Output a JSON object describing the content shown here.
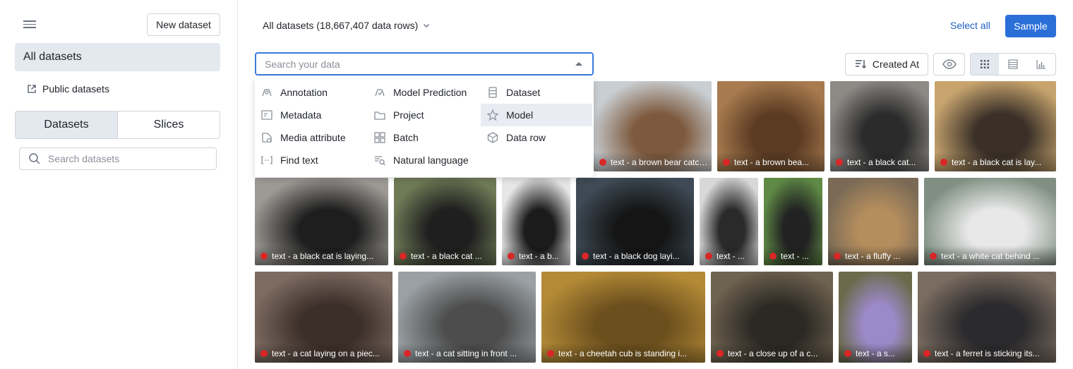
{
  "sidebar": {
    "new_dataset": "New dataset",
    "all_datasets": "All datasets",
    "public_datasets": "Public datasets",
    "tabs": [
      "Datasets",
      "Slices"
    ],
    "search_placeholder": "Search datasets"
  },
  "header": {
    "title": "All datasets (18,667,407 data rows)",
    "select_all": "Select all",
    "sample": "Sample"
  },
  "search": {
    "placeholder": "Search your data"
  },
  "toolbar": {
    "sort_label": "Created At"
  },
  "filters": [
    {
      "label": "Annotation",
      "icon": "annotation-icon"
    },
    {
      "label": "Model Prediction",
      "icon": "model-prediction-icon"
    },
    {
      "label": "Dataset",
      "icon": "dataset-icon"
    },
    {
      "label": "Metadata",
      "icon": "metadata-icon"
    },
    {
      "label": "Project",
      "icon": "folder-icon"
    },
    {
      "label": "Model",
      "icon": "model-icon"
    },
    {
      "label": "Media attribute",
      "icon": "media-attribute-icon"
    },
    {
      "label": "Batch",
      "icon": "batch-icon"
    },
    {
      "label": "Data row",
      "icon": "data-row-icon"
    },
    {
      "label": "Find text",
      "icon": "find-text-icon"
    },
    {
      "label": "Natural language",
      "icon": "natural-language-icon"
    }
  ],
  "tiles": [
    {
      "caption": "text - a brown bear catche...",
      "colors": [
        "#c9ced2",
        "#7d5a3e"
      ]
    },
    {
      "caption": "text - a brown bea...",
      "colors": [
        "#a87b4f",
        "#5b3b22"
      ]
    },
    {
      "caption": "text - a black cat...",
      "colors": [
        "#8d8a86",
        "#2b2b2b"
      ]
    },
    {
      "caption": "text - a black cat is lay...",
      "colors": [
        "#c7a46e",
        "#3a3028"
      ]
    },
    {
      "caption": "text - a black cat is laying...",
      "colors": [
        "#9d9a95",
        "#1e1e1e"
      ]
    },
    {
      "caption": "text - a black cat ...",
      "colors": [
        "#6f7a56",
        "#1f1f1f"
      ]
    },
    {
      "caption": "text - a b...",
      "colors": [
        "#e6e6e6",
        "#1b1b1b"
      ]
    },
    {
      "caption": "text - a black dog layi...",
      "colors": [
        "#3e4a55",
        "#151515"
      ]
    },
    {
      "caption": "text - ...",
      "colors": [
        "#d8d8d8",
        "#2a2a2a"
      ]
    },
    {
      "caption": "text - ...",
      "colors": [
        "#5f8a46",
        "#222"
      ]
    },
    {
      "caption": "text - a fluffy ...",
      "colors": [
        "#7a6a55",
        "#b58e5e"
      ]
    },
    {
      "caption": "text - a white cat behind ...",
      "colors": [
        "#7f8f82",
        "#e8e8e8"
      ]
    },
    {
      "caption": "text - a cat laying on a piec...",
      "colors": [
        "#7c6b61",
        "#3c2f29"
      ]
    },
    {
      "caption": "text - a cat sitting in front ...",
      "colors": [
        "#9aa0a4",
        "#4d4d4d"
      ]
    },
    {
      "caption": "text - a cheetah cub is standing i...",
      "colors": [
        "#b48a36",
        "#6b4f1d"
      ]
    },
    {
      "caption": "text - a close up of a c...",
      "colors": [
        "#6e6250",
        "#2c2924"
      ]
    },
    {
      "caption": "text - a s...",
      "colors": [
        "#6b6a4a",
        "#9c89c9"
      ]
    },
    {
      "caption": "text - a ferret is sticking its...",
      "colors": [
        "#7a6c60",
        "#2b2a2d"
      ]
    }
  ]
}
